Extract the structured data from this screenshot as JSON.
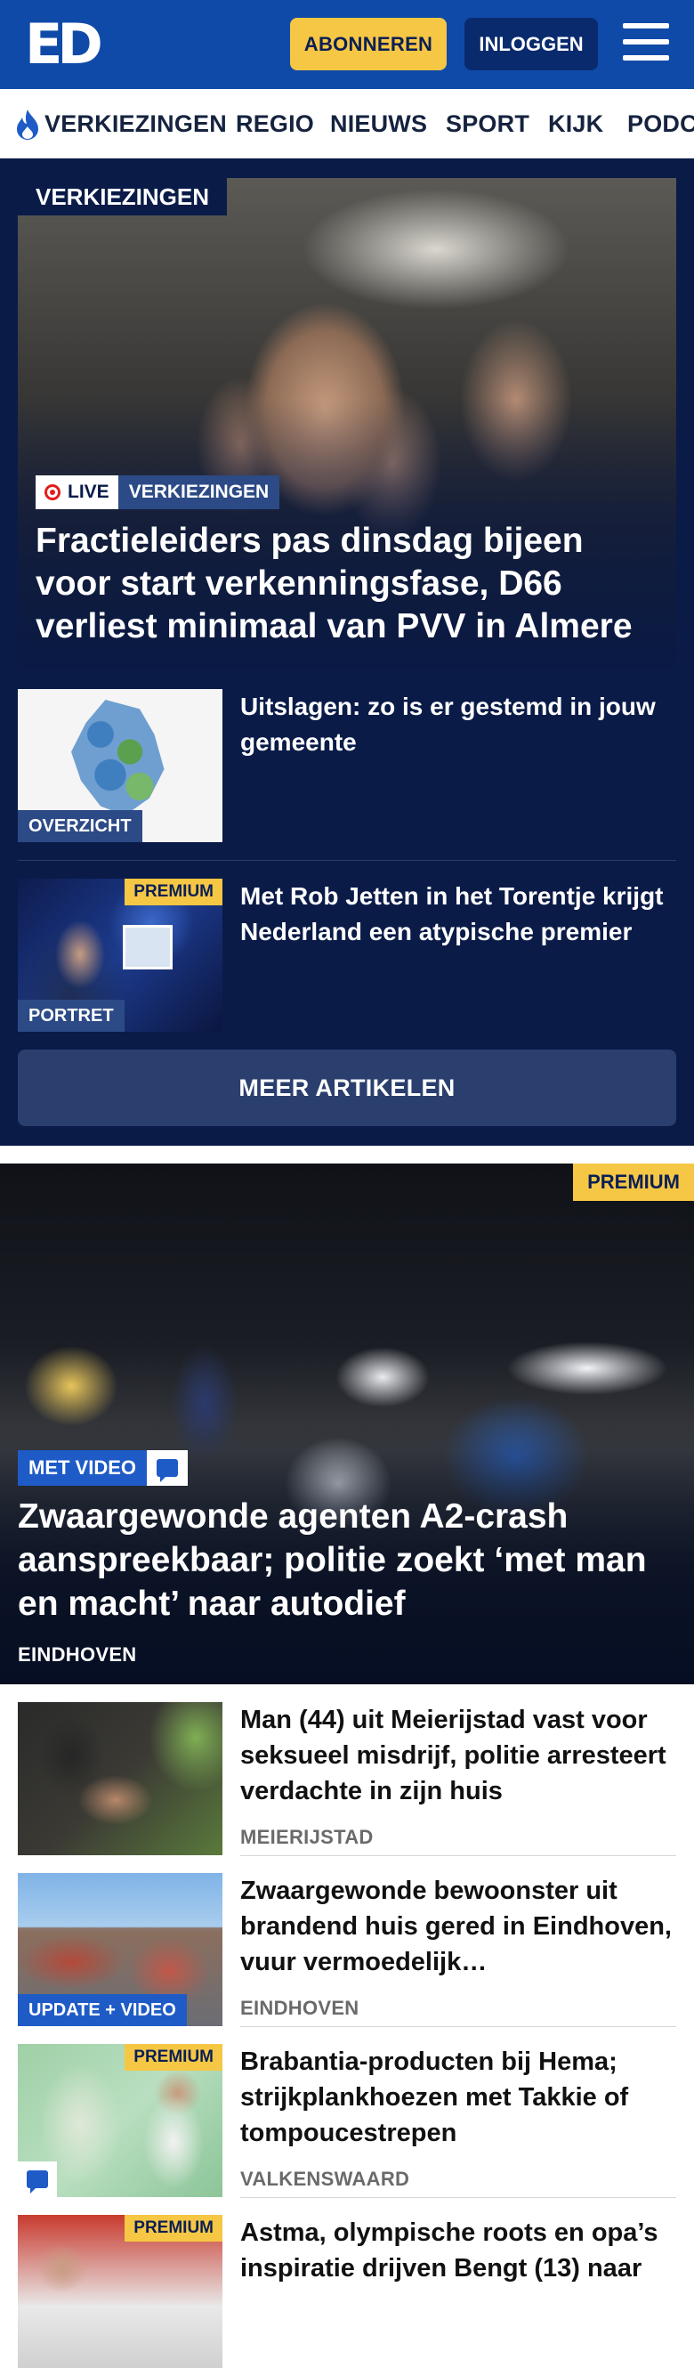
{
  "header": {
    "logo": "ED",
    "subscribe_label": "ABONNEREN",
    "login_label": "INLOGGEN"
  },
  "nav": {
    "items": [
      {
        "label": "VERKIEZINGEN",
        "icon": "flame-icon"
      },
      {
        "label": "REGIO"
      },
      {
        "label": "NIEUWS"
      },
      {
        "label": "SPORT"
      },
      {
        "label": "KIJK"
      },
      {
        "label": "PODC"
      }
    ]
  },
  "election": {
    "section_label": "VERKIEZINGEN",
    "hero": {
      "live_label": "LIVE",
      "category": "VERKIEZINGEN",
      "title": "Fractieleiders pas dinsdag bijeen voor start verkenningsfase, D66 verliest minimaal van PVV in Almere"
    },
    "articles": [
      {
        "title": "Uitslagen: zo is er gestemd in jouw gemeente",
        "label": "OVERZICHT"
      },
      {
        "title": "Met Rob Jetten in het Torentje krijgt Nederland een atypische premier",
        "label": "PORTRET",
        "premium": "PREMIUM"
      }
    ],
    "more_label": "MEER ARTIKELEN"
  },
  "feature": {
    "premium": "PREMIUM",
    "video_label": "MET VIDEO",
    "title": "Zwaargewonde agenten A2-crash aanspreekbaar; politie zoekt ‘met man en macht’ naar autodief",
    "location": "EINDHOVEN"
  },
  "news": [
    {
      "title": "Man (44) uit Meierijstad vast voor seksueel misdrijf, politie arresteert verdachte in zijn huis",
      "location": "MEIERIJSTAD"
    },
    {
      "title": "Zwaargewonde bewoonster uit brandend huis gered in Eindhoven, vuur vermoedelijk…",
      "location": "EINDHOVEN",
      "badge": "UPDATE + VIDEO"
    },
    {
      "title": "Brabantia-producten bij Hema; strijkplankhoezen met Takkie of tompoucestrepen",
      "location": "VALKENSWAARD",
      "premium": "PREMIUM"
    },
    {
      "title": "Astma, olympische roots en opa’s inspiratie drijven Bengt (13) naar",
      "premium": "PREMIUM"
    }
  ],
  "colors": {
    "brand_blue": "#0f4aa8",
    "navy": "#0a1b48",
    "premium_yellow": "#f6c744",
    "live_red": "#e31d1a"
  }
}
